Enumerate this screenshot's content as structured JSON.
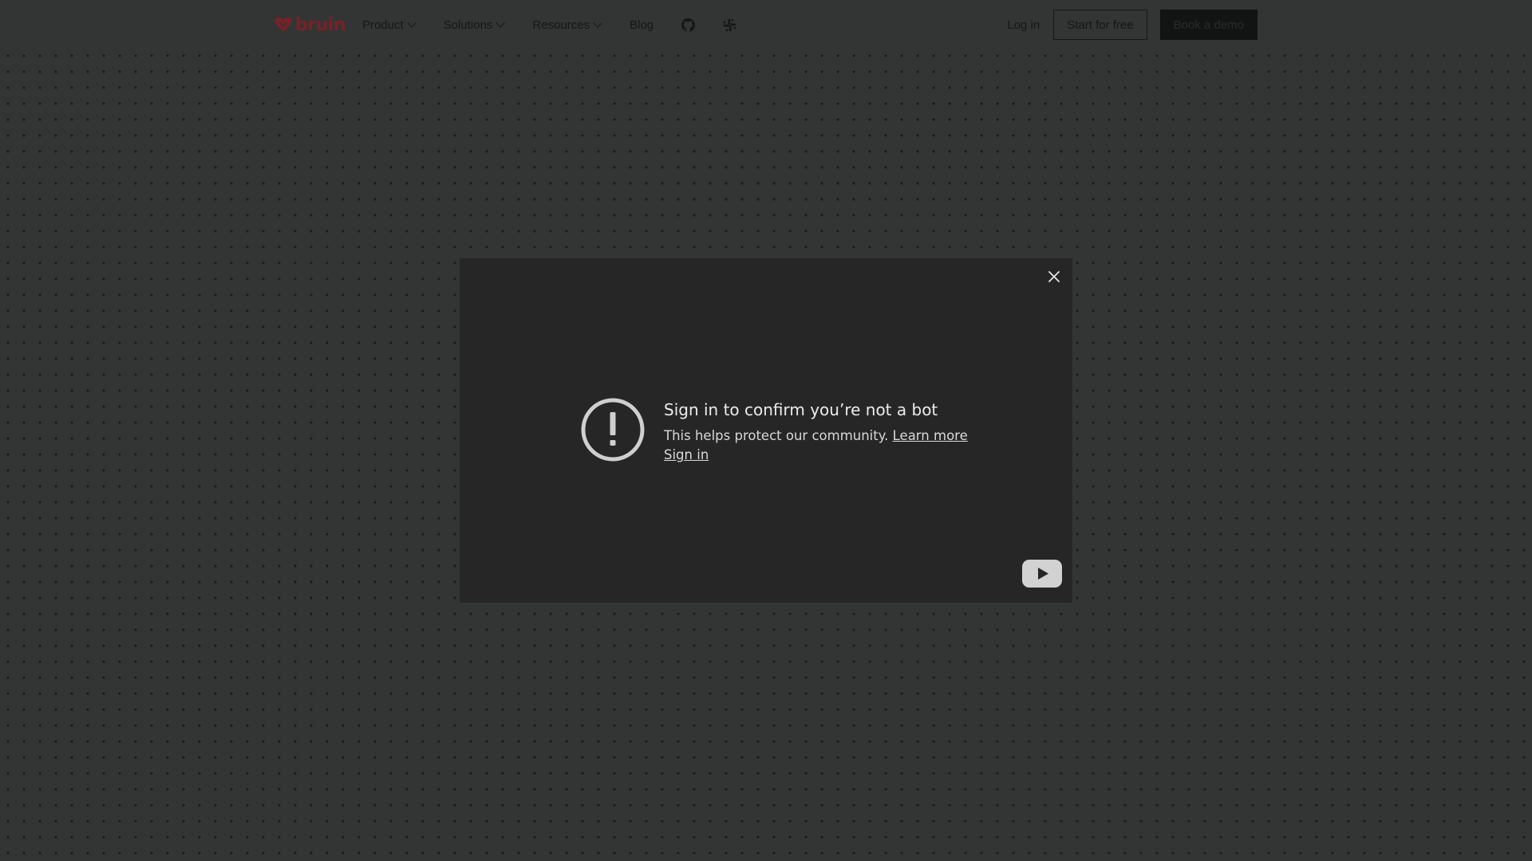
{
  "brand": {
    "logo_text": "bruin",
    "logo_color": "#7a2127"
  },
  "nav": {
    "items": [
      {
        "label": "Product",
        "has_dropdown": true
      },
      {
        "label": "Solutions",
        "has_dropdown": true
      },
      {
        "label": "Resources",
        "has_dropdown": true
      },
      {
        "label": "Blog",
        "has_dropdown": false
      }
    ],
    "icons": [
      "github-icon",
      "slack-icon"
    ],
    "login_label": "Log in",
    "start_label": "Start for free",
    "demo_label": "Book a demo"
  },
  "video": {
    "title": "Sign in to confirm you’re not a bot",
    "body": "This helps protect our community.",
    "learn_more_label": "Learn more",
    "sign_in_label": "Sign in",
    "close_icon": "close-icon",
    "platform_icon": "youtube-logo-icon",
    "alert_icon": "exclamation-circle-icon"
  },
  "colors": {
    "page_bg": "#333534",
    "modal_bg": "#262626",
    "text_dark": "#151616",
    "button_dark": "#121313"
  }
}
